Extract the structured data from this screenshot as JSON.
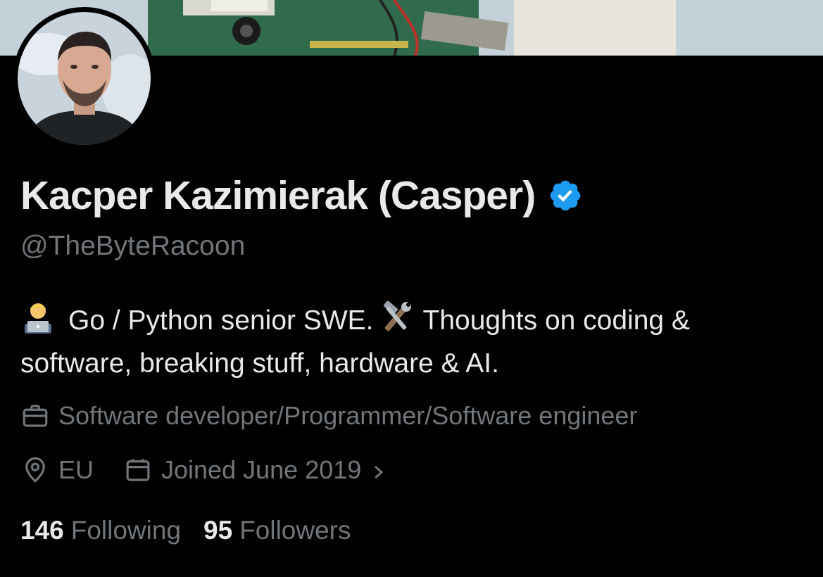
{
  "profile": {
    "display_name": "Kacper Kazimierak (Casper)",
    "handle": "@TheByteRacoon",
    "verified": true,
    "bio": {
      "emoji_1": "technologist-emoji",
      "text_1": "Go / Python senior SWE.",
      "emoji_2": "hammer-and-wrench-emoji",
      "text_2": "Thoughts on coding & software, breaking stuff, hardware & AI."
    },
    "profession": "Software developer/Programmer/Software engineer",
    "location": "EU",
    "joined": "Joined June 2019"
  },
  "stats": {
    "following_count": "146",
    "following_label": "Following",
    "followers_count": "95",
    "followers_label": "Followers"
  },
  "colors": {
    "background": "#000000",
    "primary_text": "#e7e9ea",
    "secondary_text": "#71767b",
    "verified_blue": "#1d9bf0"
  },
  "icons": [
    "verified-badge-icon",
    "briefcase-icon",
    "location-pin-icon",
    "calendar-icon",
    "chevron-right-icon"
  ]
}
